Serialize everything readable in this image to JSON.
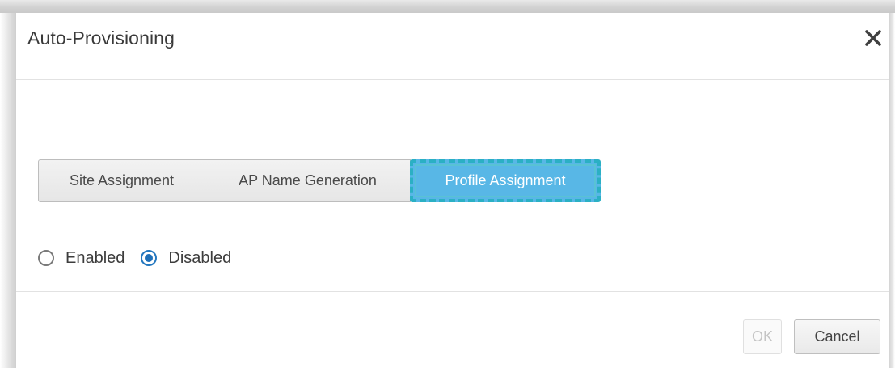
{
  "dialog": {
    "title": "Auto-Provisioning",
    "close_icon": "close-icon"
  },
  "tabs": [
    {
      "label": "Site Assignment",
      "active": false
    },
    {
      "label": "AP Name Generation",
      "active": false
    },
    {
      "label": "Profile Assignment",
      "active": true
    }
  ],
  "radio": {
    "options": [
      {
        "label": "Enabled",
        "checked": false
      },
      {
        "label": "Disabled",
        "checked": true
      }
    ]
  },
  "footer": {
    "ok_label": "OK",
    "ok_disabled": true,
    "cancel_label": "Cancel"
  },
  "colors": {
    "active_tab": "#58b7e6",
    "highlight_border": "#2bb0c4",
    "radio_checked": "#1e6fb8"
  }
}
